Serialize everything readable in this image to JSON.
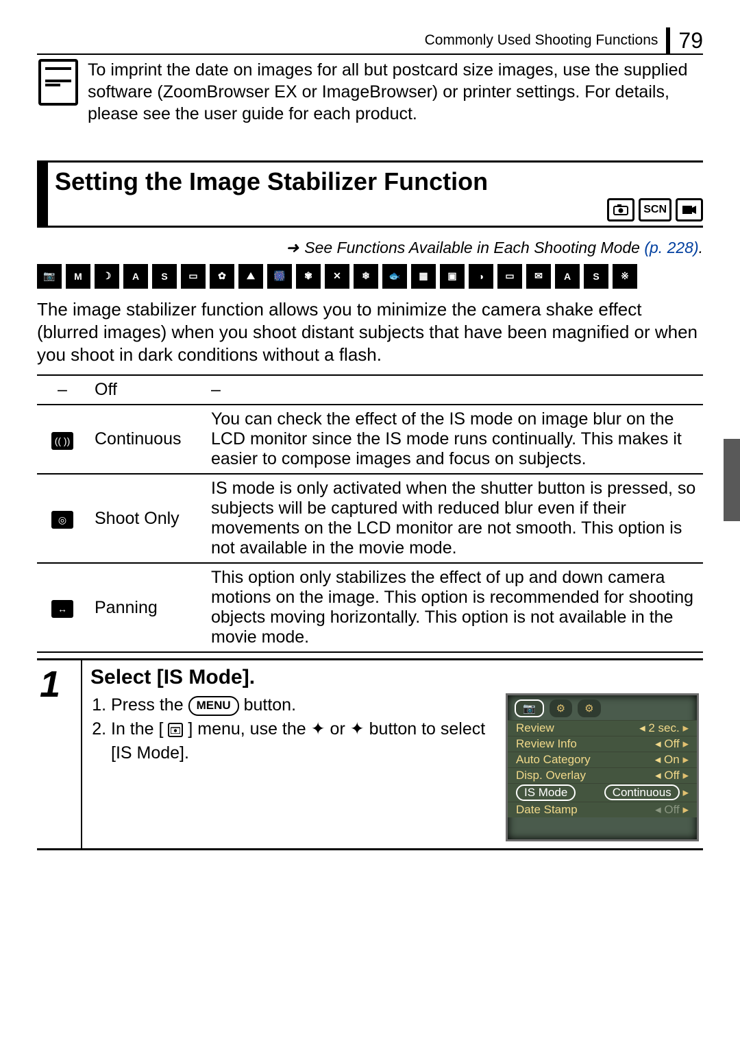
{
  "header": {
    "title": "Commonly Used Shooting Functions",
    "pageNumber": "79"
  },
  "note": {
    "text": "To imprint the date on images for all but postcard size images, use the supplied software (ZoomBrowser EX or ImageBrowser) or printer settings. For details, please see the user guide for each product."
  },
  "section": {
    "title": "Setting the Image Stabilizer Function",
    "badges": {
      "camera": "●",
      "scn": "SCN",
      "movie": "▀"
    }
  },
  "xref": {
    "arrow": "➜",
    "text": "See Functions Available in Each Shooting Mode",
    "link": "(p. 228)",
    "dot": "."
  },
  "body": "The image stabilizer function allows you to minimize the camera shake effect (blurred images) when you shoot distant subjects that have been magnified or when you shoot in dark conditions without a flash.",
  "table": {
    "rows": [
      {
        "icon": "–",
        "label": "Off",
        "desc": "–"
      },
      {
        "icon": "⦿",
        "label": "Continuous",
        "desc": "You can check the effect of the IS mode on image blur on the LCD monitor since the IS mode runs continually. This makes it easier to compose images and focus on subjects."
      },
      {
        "icon": "◎",
        "label": "Shoot Only",
        "desc": "IS mode is only activated when the shutter button is pressed, so subjects will be captured with reduced blur even if their movements on the LCD monitor are not smooth. This option is not available in the movie mode."
      },
      {
        "icon": "↔",
        "label": "Panning",
        "desc": "This option only stabilizes the effect of up and down camera motions on the image. This option is recommended for shooting objects moving horizontally. This option is not available in the movie mode."
      }
    ]
  },
  "step": {
    "number": "1",
    "title": "Select [IS Mode].",
    "items": {
      "i1a": "Press the ",
      "menu": "MENU",
      "i1b": " button.",
      "i2a": "In the [",
      "cam": "●",
      "i2b": "] menu, use the ",
      "up": "✦",
      "or": " or ",
      "down": "✦",
      "i2c": " button to select [IS Mode]."
    }
  },
  "lcd": {
    "tab1": "📷",
    "tab2": "⚙",
    "tab3": "⚙",
    "rows": [
      {
        "label": "Review",
        "value": "2 sec."
      },
      {
        "label": "Review Info",
        "value": "Off"
      },
      {
        "label": "Auto Category",
        "value": "On"
      },
      {
        "label": "Disp. Overlay",
        "value": "Off"
      },
      {
        "label": "IS Mode",
        "value": "Continuous"
      },
      {
        "label": "Date Stamp",
        "value": "Off"
      }
    ]
  }
}
